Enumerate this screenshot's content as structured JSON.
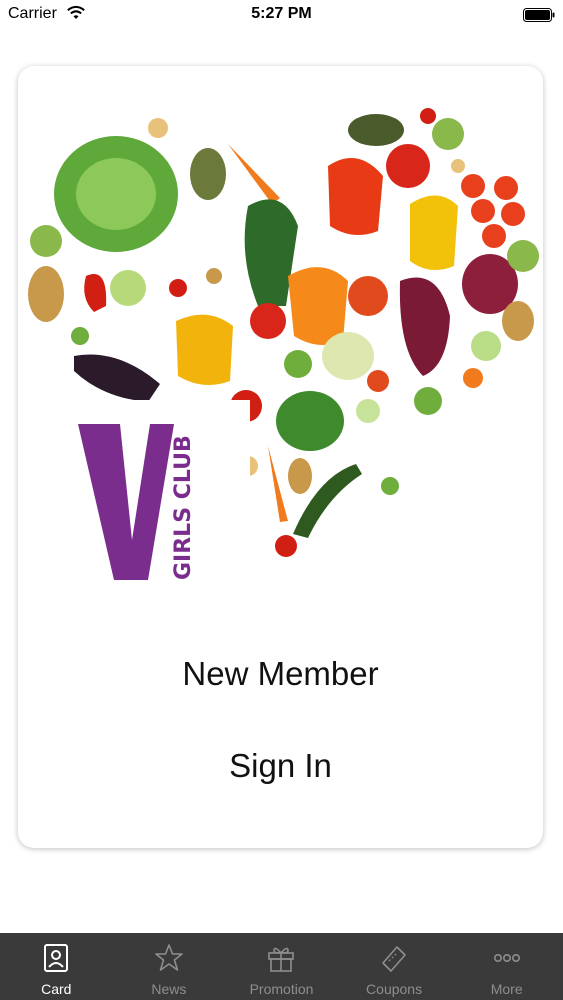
{
  "status_bar": {
    "carrier": "Carrier",
    "time": "5:27 PM"
  },
  "logo": {
    "text": "GIRLS CLUB",
    "letter": "V",
    "color": "#7b2d8e"
  },
  "card": {
    "new_member_label": "New Member",
    "sign_in_label": "Sign In"
  },
  "tab_bar": {
    "active_color": "#ffffff",
    "inactive_color": "#8e8e8e",
    "tabs": [
      {
        "label": "Card",
        "icon": "card-icon",
        "active": true
      },
      {
        "label": "News",
        "icon": "star-icon",
        "active": false
      },
      {
        "label": "Promotion",
        "icon": "gift-icon",
        "active": false
      },
      {
        "label": "Coupons",
        "icon": "ticket-icon",
        "active": false
      },
      {
        "label": "More",
        "icon": "more-icon",
        "active": false
      }
    ]
  }
}
